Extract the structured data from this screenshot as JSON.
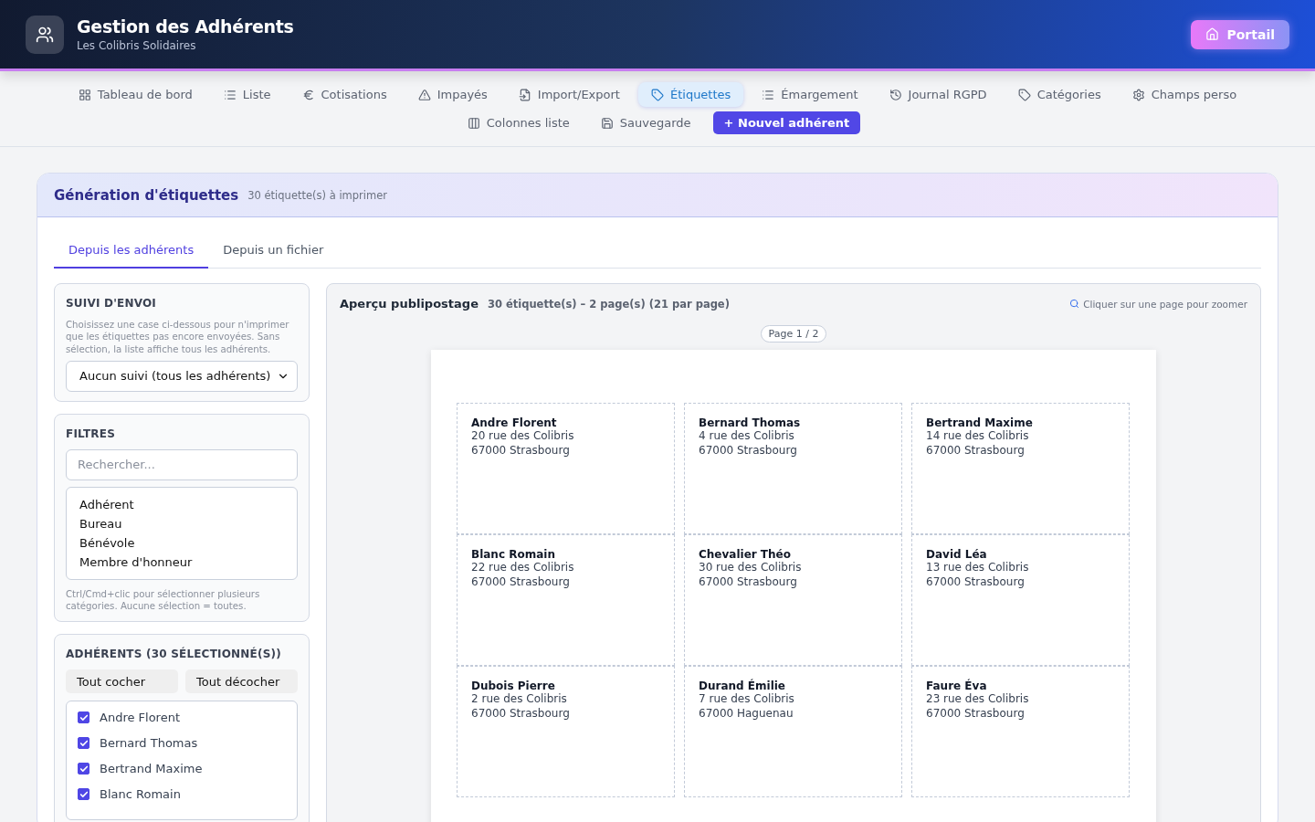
{
  "header": {
    "title": "Gestion des Adhérents",
    "subtitle": "Les Colibris Solidaires",
    "portal_button": "Portail"
  },
  "nav": {
    "row_1": [
      {
        "label": "Tableau de bord",
        "selected": false
      },
      {
        "label": "Liste",
        "selected": false
      },
      {
        "label": "Cotisations",
        "selected": false
      },
      {
        "label": "Impayés",
        "selected": false
      },
      {
        "label": "Import/Export",
        "selected": false
      },
      {
        "label": "Étiquettes",
        "selected": true
      },
      {
        "label": "Émargement",
        "selected": false
      },
      {
        "label": "Journal RGPD",
        "selected": false
      },
      {
        "label": "Catégories",
        "selected": false
      },
      {
        "label": "Champs perso",
        "selected": false
      }
    ],
    "row_2": [
      {
        "label": "Colonnes liste",
        "selected": false
      },
      {
        "label": "Sauvegarde",
        "selected": false
      }
    ],
    "new_button": "+ Nouvel adhérent"
  },
  "card": {
    "title": "Génération d'étiquettes",
    "count": "30 étiquette(s) à imprimer",
    "tabs": [
      {
        "label": "Depuis les adhérents",
        "selected": true
      },
      {
        "label": "Depuis un fichier",
        "selected": false
      }
    ]
  },
  "tracking": {
    "heading": "SUIVI D'ENVOI",
    "help": "Choisissez une case ci-dessous pour n'imprimer que les étiquettes pas encore envoyées. Sans sélection, la liste affiche tous les adhérents.",
    "select_value": "Aucun suivi (tous les adhérents)"
  },
  "filters": {
    "heading": "FILTRES",
    "search_placeholder": "Rechercher...",
    "categories": [
      {
        "label": "Adhérent",
        "selected": false
      },
      {
        "label": "Bureau",
        "selected": false
      },
      {
        "label": "Bénévole",
        "selected": false
      },
      {
        "label": "Membre d'honneur",
        "selected": false
      }
    ],
    "help": "Ctrl/Cmd+clic pour sélectionner plusieurs catégories. Aucune sélection = toutes."
  },
  "members": {
    "heading": "ADHÉRENTS (30 SÉLECTIONNÉ(S))",
    "check_all": "Tout cocher",
    "uncheck_all": "Tout décocher",
    "items": [
      {
        "name": "Andre Florent",
        "checked": true
      },
      {
        "name": "Bernard Thomas",
        "checked": true
      },
      {
        "name": "Bertrand Maxime",
        "checked": true
      },
      {
        "name": "Blanc Romain",
        "checked": true
      }
    ]
  },
  "preview": {
    "title": "Aperçu publipostage",
    "summary": "30 étiquette(s) – 2 page(s) (21 par page)",
    "zoom_hint": "Cliquer sur une page pour zoomer",
    "page_badge": "Page 1 / 2",
    "labels": [
      {
        "name": "Andre Florent",
        "street": "20 rue des Colibris",
        "city": "67000 Strasbourg"
      },
      {
        "name": "Bernard Thomas",
        "street": "4 rue des Colibris",
        "city": "67000 Strasbourg"
      },
      {
        "name": "Bertrand Maxime",
        "street": "14 rue des Colibris",
        "city": "67000 Strasbourg"
      },
      {
        "name": "Blanc Romain",
        "street": "22 rue des Colibris",
        "city": "67000 Strasbourg"
      },
      {
        "name": "Chevalier Théo",
        "street": "30 rue des Colibris",
        "city": "67000 Strasbourg"
      },
      {
        "name": "David Léa",
        "street": "13 rue des Colibris",
        "city": "67000 Strasbourg"
      },
      {
        "name": "Dubois Pierre",
        "street": "2 rue des Colibris",
        "city": "67000 Strasbourg"
      },
      {
        "name": "Durand Émilie",
        "street": "7 rue des Colibris",
        "city": "67000 Haguenau"
      },
      {
        "name": "Faure Éva",
        "street": "23 rue des Colibris",
        "city": "67000 Strasbourg"
      }
    ]
  }
}
